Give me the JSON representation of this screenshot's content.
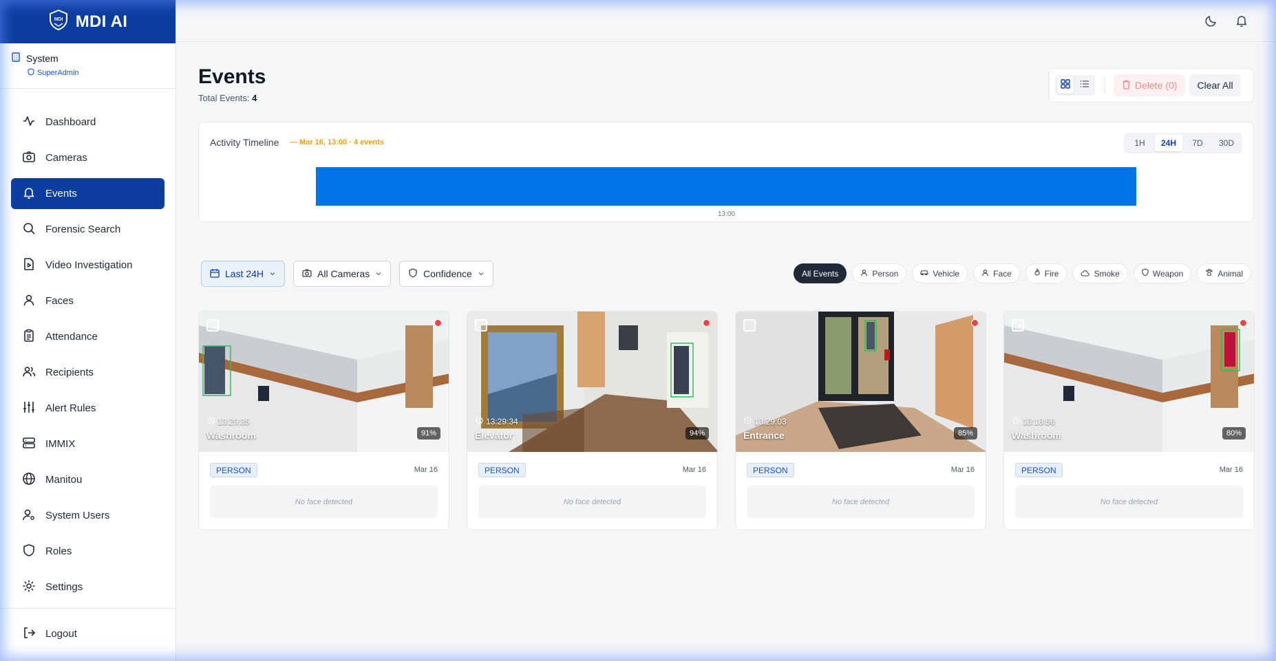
{
  "brand": {
    "name": "MDI AI",
    "logo_text": "MDI"
  },
  "org": {
    "name": "System",
    "role": "SuperAdmin"
  },
  "nav": {
    "items": [
      {
        "label": "Dashboard",
        "icon": "activity-icon"
      },
      {
        "label": "Cameras",
        "icon": "camera-icon"
      },
      {
        "label": "Events",
        "icon": "bell-icon",
        "active": true
      },
      {
        "label": "Forensic Search",
        "icon": "search-icon"
      },
      {
        "label": "Video Investigation",
        "icon": "file-video-icon"
      },
      {
        "label": "Faces",
        "icon": "user-icon"
      },
      {
        "label": "Attendance",
        "icon": "clipboard-icon"
      },
      {
        "label": "Recipients",
        "icon": "users-icon"
      },
      {
        "label": "Alert Rules",
        "icon": "sliders-icon"
      },
      {
        "label": "IMMIX",
        "icon": "server-icon"
      },
      {
        "label": "Manitou",
        "icon": "globe-icon"
      },
      {
        "label": "System Users",
        "icon": "user-cog-icon"
      },
      {
        "label": "Roles",
        "icon": "shield-icon"
      },
      {
        "label": "Settings",
        "icon": "gear-icon"
      }
    ],
    "logout": "Logout"
  },
  "header": {
    "title": "Events",
    "total_label": "Total Events:",
    "total_value": "4"
  },
  "toolbar": {
    "delete_label": "Delete (0)",
    "clear_label": "Clear All"
  },
  "timeline": {
    "title": "Activity Timeline",
    "subtitle": "— Mar 16, 13:00 · 4 events",
    "ranges": [
      "1H",
      "24H",
      "7D",
      "30D"
    ],
    "active_range": "24H",
    "tick": "13:00",
    "colors": {
      "bar": "#0073e6"
    }
  },
  "filters": {
    "time": "Last 24H",
    "cameras": "All Cameras",
    "confidence": "Confidence"
  },
  "chips": [
    "All Events",
    "Person",
    "Vehicle",
    "Face",
    "Fire",
    "Smoke",
    "Weapon",
    "Animal"
  ],
  "events": [
    {
      "time": "13:29:35",
      "camera": "Washroom",
      "confidence": "91%",
      "type": "PERSON",
      "date": "Mar 16",
      "face": "No face detected"
    },
    {
      "time": "13:29:34",
      "camera": "Elevator",
      "confidence": "94%",
      "type": "PERSON",
      "date": "Mar 16",
      "face": "No face detected"
    },
    {
      "time": "13:29:03",
      "camera": "Entrance",
      "confidence": "85%",
      "type": "PERSON",
      "date": "Mar 16",
      "face": "No face detected"
    },
    {
      "time": "13:18:56",
      "camera": "Washroom",
      "confidence": "80%",
      "type": "PERSON",
      "date": "Mar 16",
      "face": "No face detected"
    }
  ],
  "colors": {
    "brand": "#0a3d9e",
    "accent": "#0073e6",
    "danger": "#ef4444"
  }
}
